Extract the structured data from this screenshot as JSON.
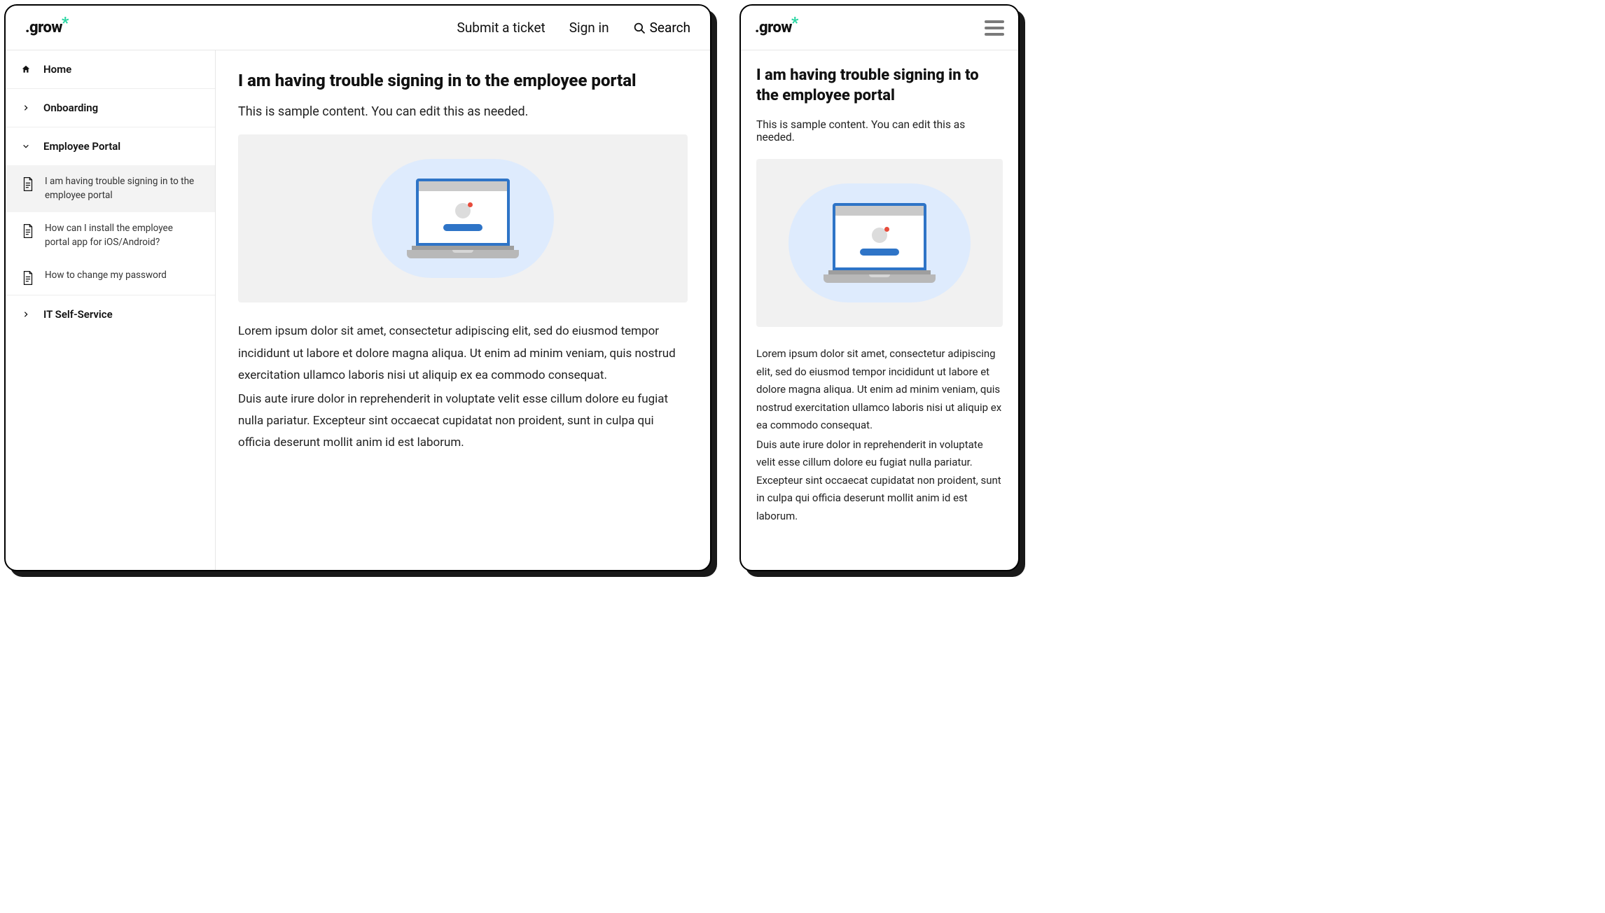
{
  "brand": {
    "name": ".grow"
  },
  "header": {
    "submit": "Submit a ticket",
    "signin": "Sign in",
    "search": "Search"
  },
  "sidebar": {
    "home": "Home",
    "onboarding": "Onboarding",
    "employee_portal": "Employee Portal",
    "it_self_service": "IT Self-Service",
    "articles": [
      "I am having trouble signing in to the employee portal",
      "How can I install the employee portal app for iOS/Android?",
      "How to change my password"
    ]
  },
  "article": {
    "title": "I am having trouble signing in to the employee portal",
    "intro": "This is sample content. You can edit this as needed.",
    "p1": "Lorem ipsum dolor sit amet, consectetur adipiscing elit, sed do eiusmod tempor incididunt ut labore et dolore magna aliqua. Ut enim ad minim veniam, quis nostrud exercitation ullamco laboris nisi ut aliquip ex ea commodo consequat.",
    "p2": "Duis aute irure dolor in reprehenderit in voluptate velit esse cillum dolore eu fugiat nulla pariatur. Excepteur sint occaecat cupidatat non proident, sunt in culpa qui officia deserunt mollit anim id est laborum."
  }
}
